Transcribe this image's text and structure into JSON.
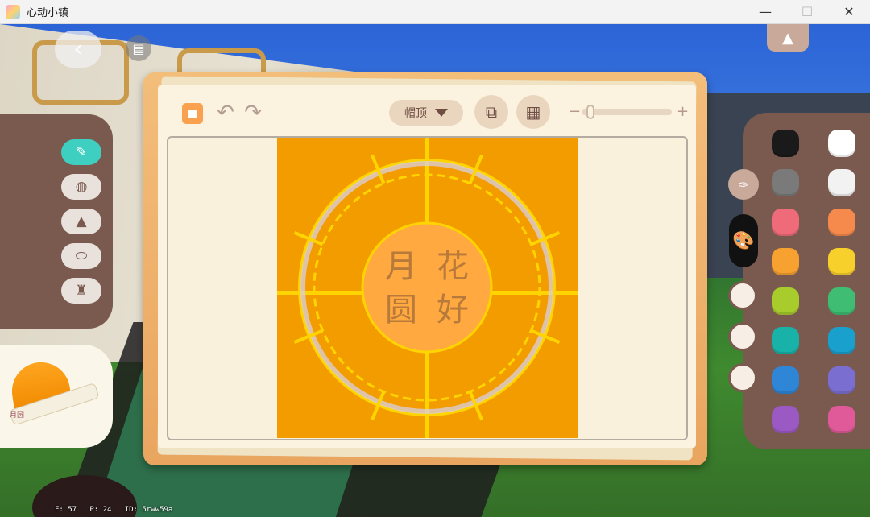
{
  "window": {
    "title": "心动小镇",
    "controls": [
      "—",
      "☐",
      "✕"
    ]
  },
  "nav": {
    "back_icon": "‹",
    "book_icon": "▤",
    "collapse_icon": "▲"
  },
  "tools": [
    {
      "name": "pencil",
      "icon": "✎",
      "active": true
    },
    {
      "name": "fill-bucket",
      "icon": "◍",
      "active": false
    },
    {
      "name": "shapes",
      "icon": "▲",
      "active": false
    },
    {
      "name": "eraser",
      "icon": "⬭",
      "active": false
    },
    {
      "name": "stamp",
      "icon": "♜",
      "active": false
    }
  ],
  "preview": {
    "label": "月圆"
  },
  "toolbar": {
    "save_icon": "■",
    "undo_icon": "↶",
    "redo_icon": "↷",
    "part_label": "帽顶",
    "mirror_icon": "⧉",
    "grid_icon": "▦",
    "zoom_minus": "−",
    "zoom_plus": "+",
    "zoom_level": 0.05
  },
  "canvas": {
    "background_color": "#f39c00",
    "inner_circle_color": "#ffa940",
    "ray_color": "#ffd400",
    "ring_color": "#d8d0e0",
    "text_color": "#b87a3a",
    "text_line1": "月 花",
    "text_line2": "圆 好"
  },
  "palette": {
    "colors": [
      "#1a1a1a",
      "#ffffff",
      "#7a7a7a",
      "#f2f2f2",
      "#f06b7a",
      "#f58a4c",
      "#f7a130",
      "#f7d02b",
      "#a8cc2c",
      "#3ebd73",
      "#19b2a8",
      "#1aa0cc",
      "#2f86d6",
      "#7a6fd0",
      "#9b59c4",
      "#e05a9a"
    ],
    "recent_colors": [
      "#f7efe6",
      "#f7efe6",
      "#f7efe6"
    ],
    "dropper_icon": "✑",
    "paint_icon": "🎨"
  },
  "debug": {
    "fps": "F: 57",
    "ping": "P: 24",
    "id": "ID: 5rww59a"
  }
}
